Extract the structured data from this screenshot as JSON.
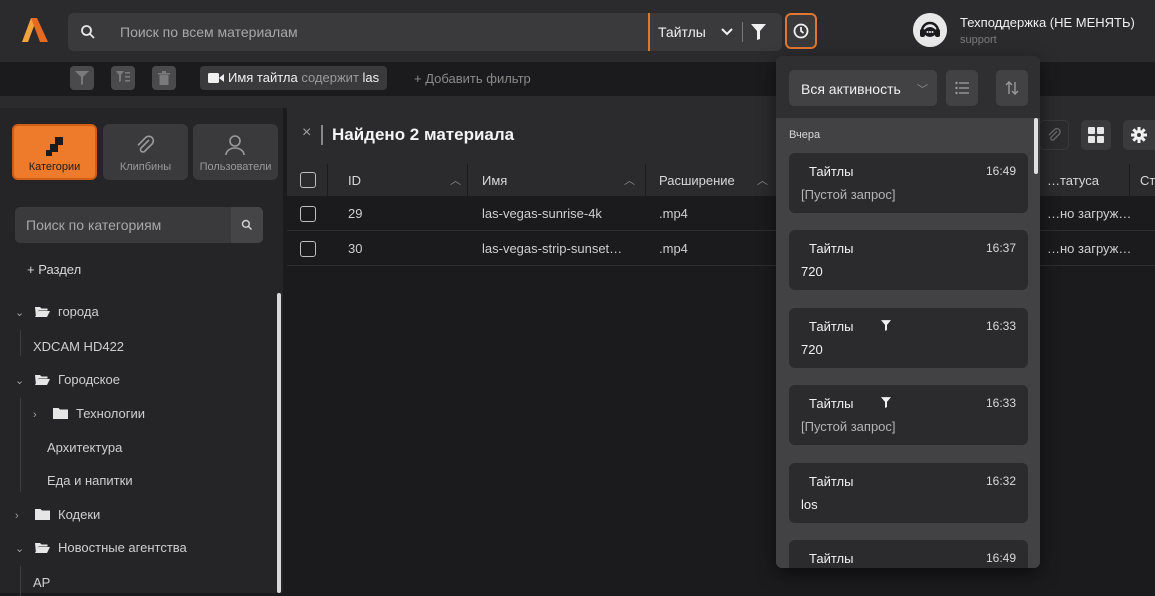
{
  "app": {
    "accent": "#ee7b2c"
  },
  "header": {
    "search_placeholder": "Поиск по всем материалам",
    "scope_label": "Тайтлы",
    "support_name": "Техподдержка (НЕ МЕНЯТЬ)",
    "support_login": "support"
  },
  "filter_bar": {
    "chip_field": "Имя тайтла",
    "chip_operator": "содержит",
    "chip_value": "las",
    "add_filter": "+ Добавить фильтр"
  },
  "sidebar": {
    "tabs": [
      {
        "label": "Категории",
        "icon": "categories-icon",
        "active": true
      },
      {
        "label": "Клипбины",
        "icon": "paperclip-icon"
      },
      {
        "label": "Пользователи",
        "icon": "user-icon"
      }
    ],
    "search_placeholder": "Поиск по категориям",
    "add_section": "+ Раздел",
    "tree": [
      {
        "label": "города",
        "chevron": "⌄",
        "folder": "open"
      },
      {
        "label": "XDCAM HD422"
      },
      {
        "label": "Городское",
        "chevron": "⌄",
        "folder": "open"
      },
      {
        "label": "Технологии",
        "chevron": "›",
        "folder": "closed"
      },
      {
        "label": "Архитектура"
      },
      {
        "label": "Еда и напитки"
      },
      {
        "label": "Кодеки",
        "chevron": "›",
        "folder": "closed"
      },
      {
        "label": "Новостные агентства",
        "chevron": "⌄",
        "folder": "open"
      },
      {
        "label": "AP"
      }
    ]
  },
  "main": {
    "found_close": "×",
    "found_title": "Найдено 2 материала",
    "columns": [
      "ID",
      "Имя",
      "Расширение",
      "…татуса",
      "Ст"
    ],
    "rows": [
      {
        "id": "29",
        "name": "las-vegas-sunrise-4k",
        "ext": ".mp4",
        "status": "…но загруж…"
      },
      {
        "id": "30",
        "name": "las-vegas-strip-sunset…",
        "ext": ".mp4",
        "status": "…но загруж…"
      }
    ]
  },
  "history": {
    "activity_label": "Вся активность",
    "group_label": "Вчера",
    "items": [
      {
        "type": "Тайтлы",
        "time": "16:49",
        "query": "[Пустой запрос]",
        "filter": false
      },
      {
        "type": "Тайтлы",
        "time": "16:37",
        "query": "720",
        "filter": false
      },
      {
        "type": "Тайтлы",
        "time": "16:33",
        "query": "720",
        "filter": true
      },
      {
        "type": "Тайтлы",
        "time": "16:33",
        "query": "[Пустой запрос]",
        "filter": true
      },
      {
        "type": "Тайтлы",
        "time": "16:32",
        "query": "los",
        "filter": false
      },
      {
        "type": "Тайтлы",
        "time": "16:49",
        "query": "",
        "filter": false
      }
    ]
  }
}
